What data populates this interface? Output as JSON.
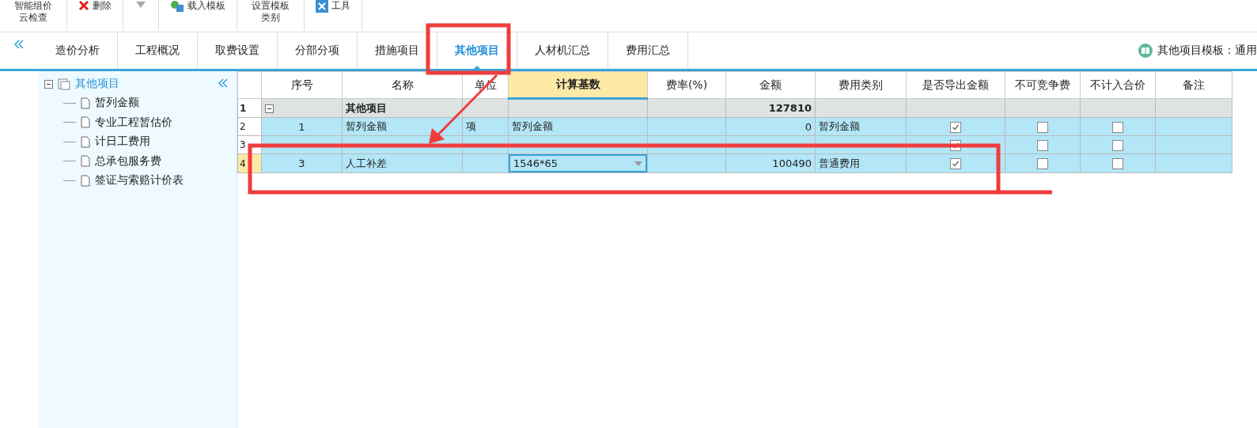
{
  "toolbar": [
    {
      "kind": "text",
      "label": "智能组价云检查"
    },
    {
      "kind": "delete",
      "label": "删除"
    },
    {
      "kind": "down"
    },
    {
      "kind": "load",
      "label": "载入模板"
    },
    {
      "kind": "text",
      "label": "设置模板类别"
    },
    {
      "kind": "tools",
      "label": "工具"
    }
  ],
  "tabs": [
    {
      "label": "造价分析",
      "selected": false
    },
    {
      "label": "工程概况",
      "selected": false
    },
    {
      "label": "取费设置",
      "selected": false
    },
    {
      "label": "分部分项",
      "selected": false
    },
    {
      "label": "措施项目",
      "selected": false
    },
    {
      "label": "其他项目",
      "selected": true
    },
    {
      "label": "人材机汇总",
      "selected": false
    },
    {
      "label": "费用汇总",
      "selected": false
    }
  ],
  "template_label": "其他项目模板：通用",
  "tree": {
    "label": "其他项目",
    "expanded": true,
    "children": [
      {
        "label": "暂列金额"
      },
      {
        "label": "专业工程暂估价"
      },
      {
        "label": "计日工费用"
      },
      {
        "label": "总承包服务费"
      },
      {
        "label": "签证与索赔计价表"
      }
    ]
  },
  "table": {
    "columns": [
      "序号",
      "名称",
      "单位",
      "计算基数",
      "费率(%)",
      "金额",
      "费用类别",
      "是否导出金额",
      "不可竞争费",
      "不计入合价",
      "备注"
    ],
    "rows": [
      {
        "kind": "group",
        "row": "1",
        "expanded": true,
        "name": "其他项目",
        "amount": "127810",
        "selected": false
      },
      {
        "kind": "item",
        "row": "2",
        "no": "1",
        "name": "暂列金额",
        "unit": "项",
        "base": "暂列金额",
        "amount": "0",
        "category": "暂列金额",
        "export": true,
        "noncompete": false,
        "exclude": false,
        "selected": false
      },
      {
        "kind": "item",
        "row": "3",
        "export": true,
        "noncompete": false,
        "exclude": false,
        "selected": false
      },
      {
        "kind": "item",
        "row": "4",
        "no": "3",
        "name": "人工补差",
        "base": "1546*65",
        "amount": "100490",
        "category": "普通费用",
        "export": true,
        "noncompete": false,
        "exclude": false,
        "selected": true
      }
    ]
  }
}
